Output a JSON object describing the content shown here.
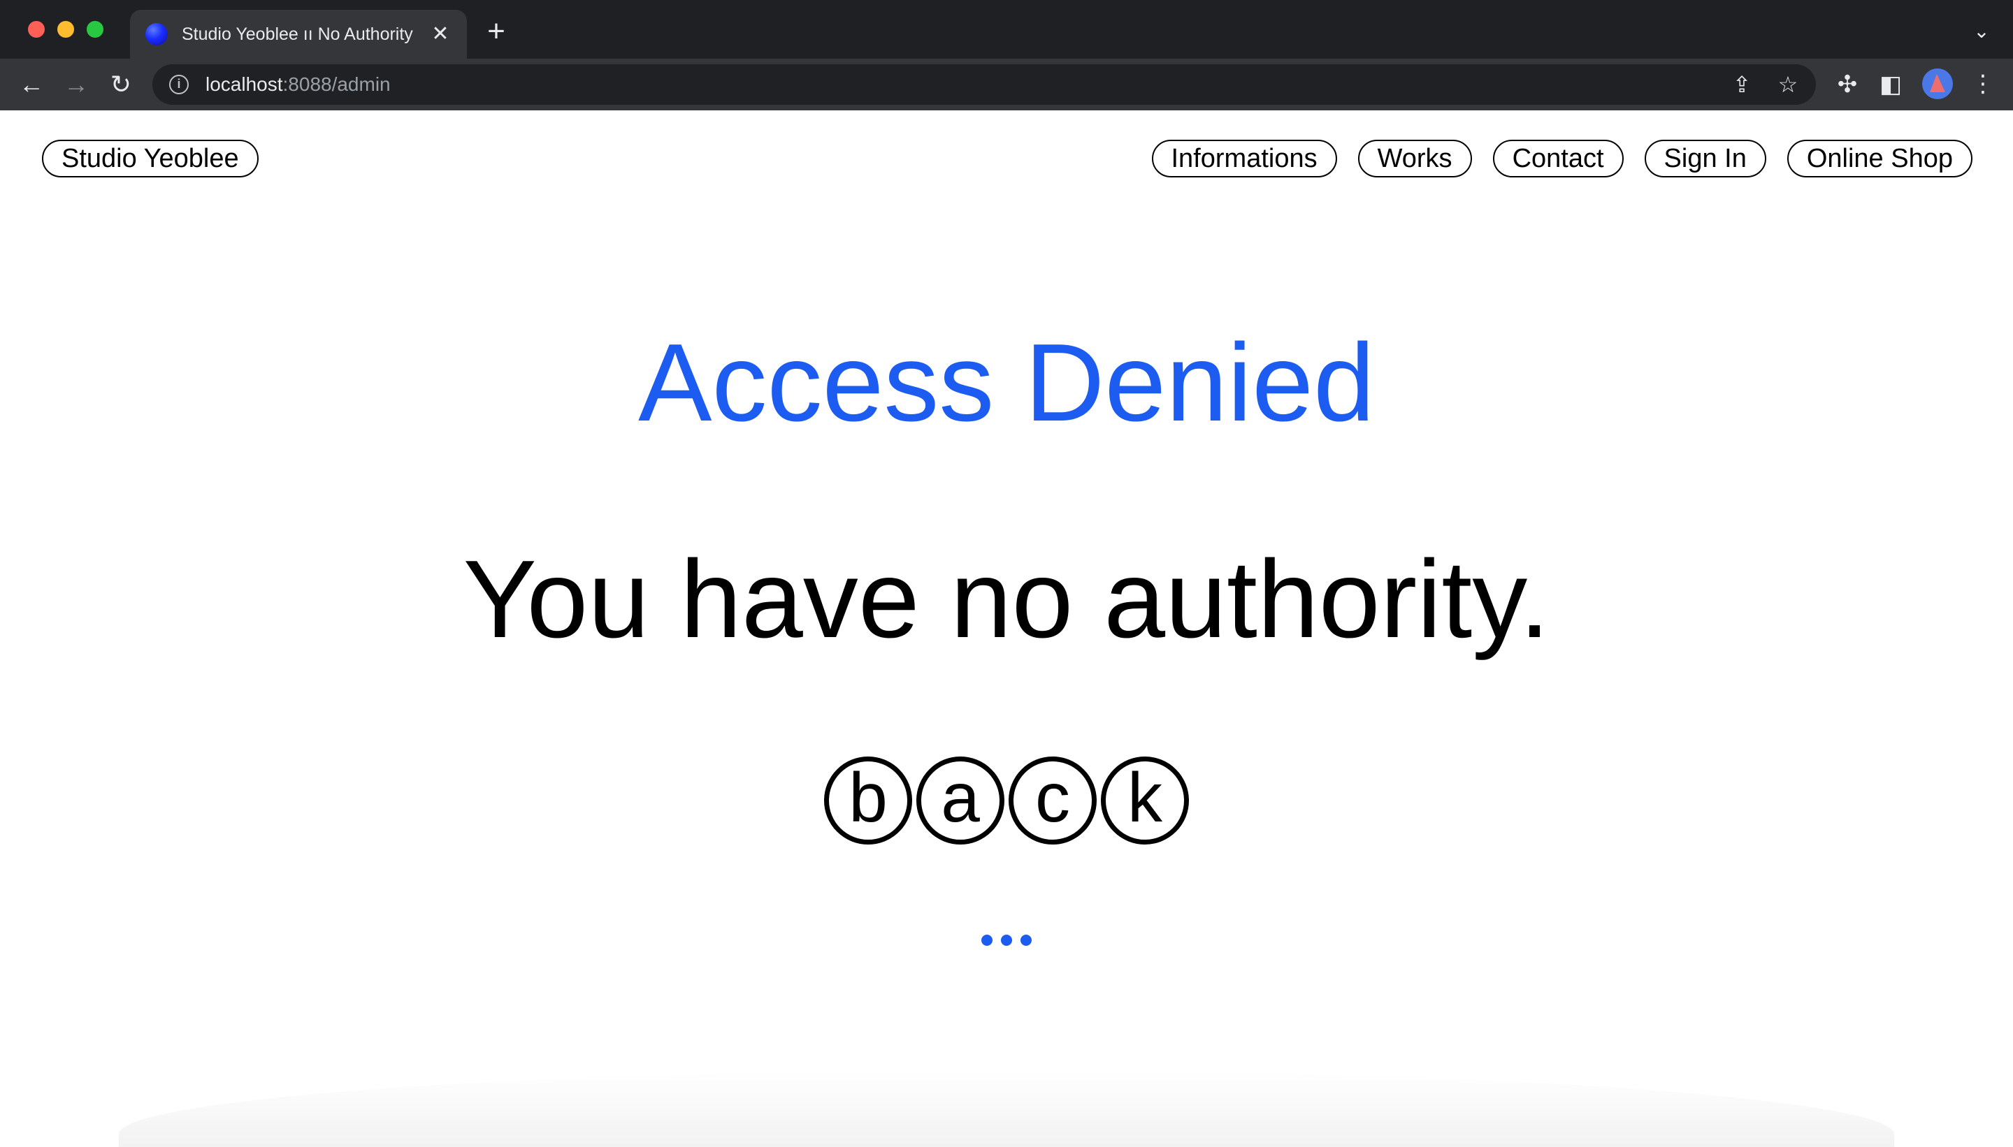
{
  "browser": {
    "tab_title": "Studio Yeoblee ıı No Authority",
    "tab_close": "✕",
    "new_tab": "+",
    "tab_menu": "⌄",
    "url_host": "localhost",
    "url_path": ":8088/admin",
    "icons": [
      "back-icon",
      "forward-icon",
      "reload-icon",
      "info-icon",
      "share-icon",
      "star-icon",
      "extensions-icon",
      "sidepanel-icon",
      "profile-icon",
      "menu-icon"
    ]
  },
  "site": {
    "brand": "Studio Yeoblee",
    "nav": [
      "Informations",
      "Works",
      "Contact",
      "Sign In",
      "Online Shop"
    ]
  },
  "main": {
    "headline": "Access Denied",
    "message": "You have no authority.",
    "back_letters": [
      "b",
      "a",
      "c",
      "k"
    ]
  },
  "colors": {
    "accent": "#1c5cf0",
    "chrome_dark": "#1f2024",
    "chrome_toolbar": "#35363a"
  }
}
